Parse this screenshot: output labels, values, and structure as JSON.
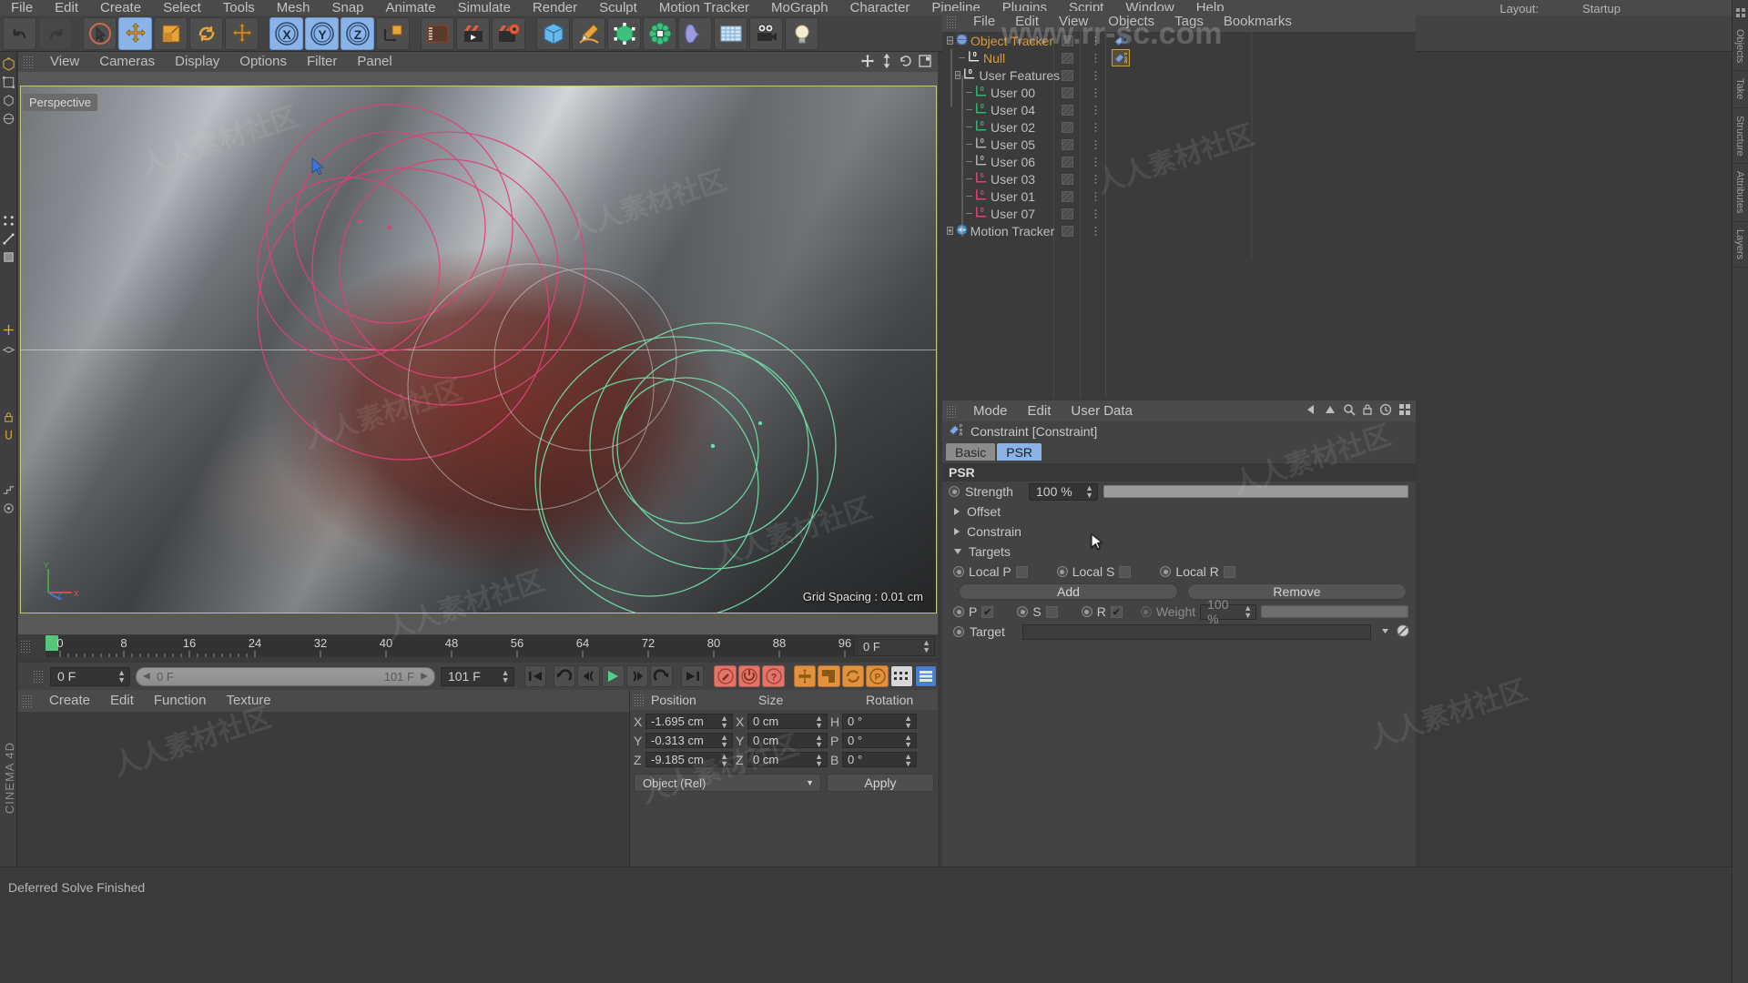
{
  "app": {
    "brand": "CINEMA 4D",
    "watermark": "www.rr-sc.com"
  },
  "top_menu": {
    "items": [
      "File",
      "Edit",
      "Create",
      "Select",
      "Tools",
      "Mesh",
      "Snap",
      "Animate",
      "Simulate",
      "Render",
      "Sculpt",
      "Motion Tracker",
      "MoGraph",
      "Character",
      "Pipeline",
      "Plugins",
      "Script",
      "Window",
      "Help"
    ],
    "layout_label": "Layout:",
    "layout_value": "Startup"
  },
  "toolbar": {
    "icons": [
      {
        "name": "undo-icon",
        "label": "Undo"
      },
      {
        "name": "redo-icon",
        "label": "Redo"
      },
      {
        "name": "live-selection-icon",
        "label": "Live Selection"
      },
      {
        "name": "move-icon",
        "label": "Move"
      },
      {
        "name": "scale-icon",
        "label": "Scale"
      },
      {
        "name": "rotate-icon",
        "label": "Rotate"
      },
      {
        "name": "move-dup-icon",
        "label": "Move"
      },
      {
        "name": "axis-x-icon",
        "label": "X"
      },
      {
        "name": "axis-y-icon",
        "label": "Y"
      },
      {
        "name": "axis-z-icon",
        "label": "Z"
      },
      {
        "name": "world-coordinates-icon",
        "label": "World/Object"
      },
      {
        "name": "render-view-icon",
        "label": "Render View"
      },
      {
        "name": "render-region-icon",
        "label": "Render to Picture Viewer"
      },
      {
        "name": "render-settings-icon",
        "label": "Render Settings"
      },
      {
        "name": "cube-primitive-icon",
        "label": "Cube"
      },
      {
        "name": "pen-spline-icon",
        "label": "Pen"
      },
      {
        "name": "generator-icon",
        "label": "Subdivision Surface"
      },
      {
        "name": "array-icon",
        "label": "Array"
      },
      {
        "name": "deformer-icon",
        "label": "Bend"
      },
      {
        "name": "floor-environment-icon",
        "label": "Floor"
      },
      {
        "name": "camera-icon",
        "label": "Camera"
      },
      {
        "name": "light-icon",
        "label": "Light"
      }
    ],
    "axis_labels": [
      "X",
      "Y",
      "Z"
    ]
  },
  "viewport": {
    "menu": [
      "View",
      "Cameras",
      "Display",
      "Options",
      "Filter",
      "Panel"
    ],
    "label": "Perspective",
    "grid_spacing": "Grid Spacing : 0.01 cm",
    "axis": {
      "x": "X",
      "y": "Y",
      "z": "Z"
    },
    "header_icons": [
      {
        "name": "viewport-move-icon"
      },
      {
        "name": "viewport-scale-icon"
      },
      {
        "name": "viewport-rotate-icon"
      },
      {
        "name": "viewport-maximize-icon"
      }
    ]
  },
  "timeline": {
    "ticks": [
      0,
      8,
      16,
      24,
      32,
      40,
      48,
      56,
      64,
      72,
      80,
      88,
      96
    ],
    "current_frame_field": "0 F",
    "end_field_right": "0 F"
  },
  "transport": {
    "start_frame": "0 F",
    "slider_left": "0 F",
    "slider_right": "101 F",
    "end_frame": "101 F",
    "buttons": [
      {
        "name": "go-to-start-button",
        "label": "Go to Start"
      },
      {
        "name": "go-to-previous-key-button",
        "label": "Go to Previous Key"
      },
      {
        "name": "go-to-previous-frame-button",
        "label": "Go to Previous Frame"
      },
      {
        "name": "play-button",
        "label": "Play"
      },
      {
        "name": "go-to-next-frame-button",
        "label": "Go to Next Frame"
      },
      {
        "name": "go-to-next-key-button",
        "label": "Go to Next Key"
      },
      {
        "name": "go-to-end-button",
        "label": "Go to End"
      },
      {
        "name": "record-active-objects-button",
        "label": "Record Active Objects"
      },
      {
        "name": "autokeying-button",
        "label": "Autokeying"
      },
      {
        "name": "keyframe-selection-button",
        "label": "Keyframe Selection"
      },
      {
        "name": "position-key-button",
        "label": "Position"
      },
      {
        "name": "scale-key-button",
        "label": "Scale"
      },
      {
        "name": "rotation-key-button",
        "label": "Rotation"
      },
      {
        "name": "parameter-key-button",
        "label": "PLA"
      },
      {
        "name": "point-level-anim-button",
        "label": "Point Level Animation"
      },
      {
        "name": "animation-layers-button",
        "label": "Animation Layers"
      }
    ]
  },
  "material_manager": {
    "menu": [
      "Create",
      "Edit",
      "Function",
      "Texture"
    ]
  },
  "coordinates": {
    "columns": [
      "Position",
      "Size",
      "Rotation"
    ],
    "position": {
      "labels": [
        "X",
        "Y",
        "Z"
      ],
      "values": [
        "-1.695 cm",
        "-0.313 cm",
        "-9.185 cm"
      ]
    },
    "size": {
      "labels": [
        "X",
        "Y",
        "Z"
      ],
      "values": [
        "0 cm",
        "0 cm",
        "0 cm"
      ]
    },
    "rotation": {
      "labels": [
        "H",
        "P",
        "B"
      ],
      "values": [
        "0 °",
        "0 °",
        "0 °"
      ]
    },
    "mode_value": "Object (Rel)",
    "apply_label": "Apply"
  },
  "status": {
    "message": "Deferred Solve Finished"
  },
  "object_manager": {
    "menu": [
      "File",
      "Edit",
      "View",
      "Objects",
      "Tags",
      "Bookmarks"
    ],
    "rows": [
      {
        "label": "Object Tracker",
        "indent": 0,
        "icon": "motion-tracker-sphere-icon",
        "color": "orange",
        "expander": "-",
        "badge": ""
      },
      {
        "label": "Null",
        "indent": 1,
        "icon": "null-object-icon",
        "color": "orange",
        "expander": "",
        "badge": "0"
      },
      {
        "label": "User Features",
        "indent": 1,
        "icon": "null-object-icon",
        "color": "gray",
        "expander": "-",
        "badge": "0"
      },
      {
        "label": "User 00",
        "indent": 2,
        "icon": "feature-track-icon",
        "color": "green",
        "expander": "",
        "badge": "0"
      },
      {
        "label": "User 04",
        "indent": 2,
        "icon": "feature-track-icon",
        "color": "green",
        "expander": "",
        "badge": "0"
      },
      {
        "label": "User 02",
        "indent": 2,
        "icon": "feature-track-icon",
        "color": "green",
        "expander": "",
        "badge": "0"
      },
      {
        "label": "User 05",
        "indent": 2,
        "icon": "feature-track-icon",
        "color": "gray",
        "expander": "",
        "badge": "0"
      },
      {
        "label": "User 06",
        "indent": 2,
        "icon": "feature-track-icon",
        "color": "gray",
        "expander": "",
        "badge": "0"
      },
      {
        "label": "User 03",
        "indent": 2,
        "icon": "feature-track-icon",
        "color": "pink",
        "expander": "",
        "badge": "0"
      },
      {
        "label": "User 01",
        "indent": 2,
        "icon": "feature-track-icon",
        "color": "pink",
        "expander": "",
        "badge": "0"
      },
      {
        "label": "User 07",
        "indent": 2,
        "icon": "feature-track-icon",
        "color": "pink",
        "expander": "",
        "badge": "0"
      },
      {
        "label": "Motion Tracker",
        "indent": 0,
        "icon": "motion-tracker-icon",
        "color": "gray",
        "expander": "+",
        "badge": ""
      }
    ],
    "tags": [
      {
        "name": "constraint-tag-icon",
        "selected": false
      },
      {
        "name": "constraint-tag-icon",
        "selected": true
      }
    ]
  },
  "attribute_manager": {
    "menu": [
      "Mode",
      "Edit",
      "User Data"
    ],
    "title": "Constraint [Constraint]",
    "tabs": [
      {
        "label": "Basic",
        "selected": false
      },
      {
        "label": "PSR",
        "selected": true
      }
    ],
    "section_psr": "PSR",
    "strength_label": "Strength",
    "strength_value": "100 %",
    "groups": [
      {
        "label": "Offset",
        "expanded": false
      },
      {
        "label": "Constrain",
        "expanded": false
      },
      {
        "label": "Targets",
        "expanded": true
      }
    ],
    "local_row": [
      {
        "label": "Local P",
        "checked": false
      },
      {
        "label": "Local S",
        "checked": false
      },
      {
        "label": "Local R",
        "checked": false
      }
    ],
    "add_label": "Add",
    "remove_label": "Remove",
    "psr_row": [
      {
        "label": "P",
        "checked": true
      },
      {
        "label": "S",
        "checked": false
      },
      {
        "label": "R",
        "checked": true
      }
    ],
    "weight_label": "Weight",
    "weight_value": "100 %",
    "target_label": "Target",
    "header_icons": [
      {
        "name": "back-arrow-icon"
      },
      {
        "name": "up-arrow-icon"
      },
      {
        "name": "search-icon"
      },
      {
        "name": "lock-icon"
      },
      {
        "name": "history-icon"
      },
      {
        "name": "grid-icon"
      }
    ]
  },
  "right_tabs": [
    {
      "label": "Objects"
    },
    {
      "label": "Take"
    },
    {
      "label": "Structure"
    },
    {
      "label": "Attributes"
    },
    {
      "label": "Layers"
    }
  ],
  "colors": {
    "accent_blue": "#8ab4e8",
    "orange_text": "#d79b3f",
    "green_track": "#2fb673",
    "pink_track": "#e0407a",
    "panel_bg": "#434343",
    "dark_bg": "#3b3b3b",
    "viewport_border": "#c9c67a",
    "play_green": "#56c77a",
    "red_button": "#e0766a",
    "orange_button": "#e2923f"
  }
}
